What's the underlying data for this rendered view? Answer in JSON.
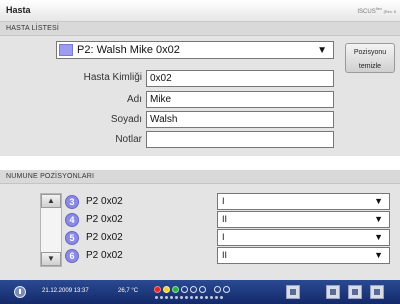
{
  "window": {
    "title": "Hasta",
    "brand": "ISCUS",
    "brand_sup": "flex",
    "revision": "[Rev. 6"
  },
  "patient_list": {
    "header": "HASTA LİSTESİ",
    "selected_patient": "P2: Walsh Mike 0x02",
    "clear_position_button": [
      "Pozisyonu",
      "temizle"
    ]
  },
  "patient_fields": {
    "id_label": "Hasta Kimliği",
    "id_value": "0x02",
    "first_name_label": "Adı",
    "first_name_value": "Mike",
    "last_name_label": "Soyadı",
    "last_name_value": "Walsh",
    "notes_label": "Notlar",
    "notes_value": ""
  },
  "sample_positions": {
    "header": "NUMUNE POZİSYONLARI",
    "rows": [
      {
        "num": "3",
        "name": "P2 0x02",
        "position": "I"
      },
      {
        "num": "4",
        "name": "P2 0x02",
        "position": "II"
      },
      {
        "num": "5",
        "name": "P2 0x02",
        "position": "I"
      },
      {
        "num": "6",
        "name": "P2 0x02",
        "position": "II"
      }
    ]
  },
  "status_bar": {
    "datetime": "21.12.2009 13:37",
    "temperature": "26,7 °C",
    "colors": {
      "red": "#e02828",
      "yellow": "#f0d22a",
      "green": "#2ab04a"
    },
    "icons": [
      "power-icon",
      "save-icon",
      "settings-icon",
      "folder-icon"
    ]
  }
}
